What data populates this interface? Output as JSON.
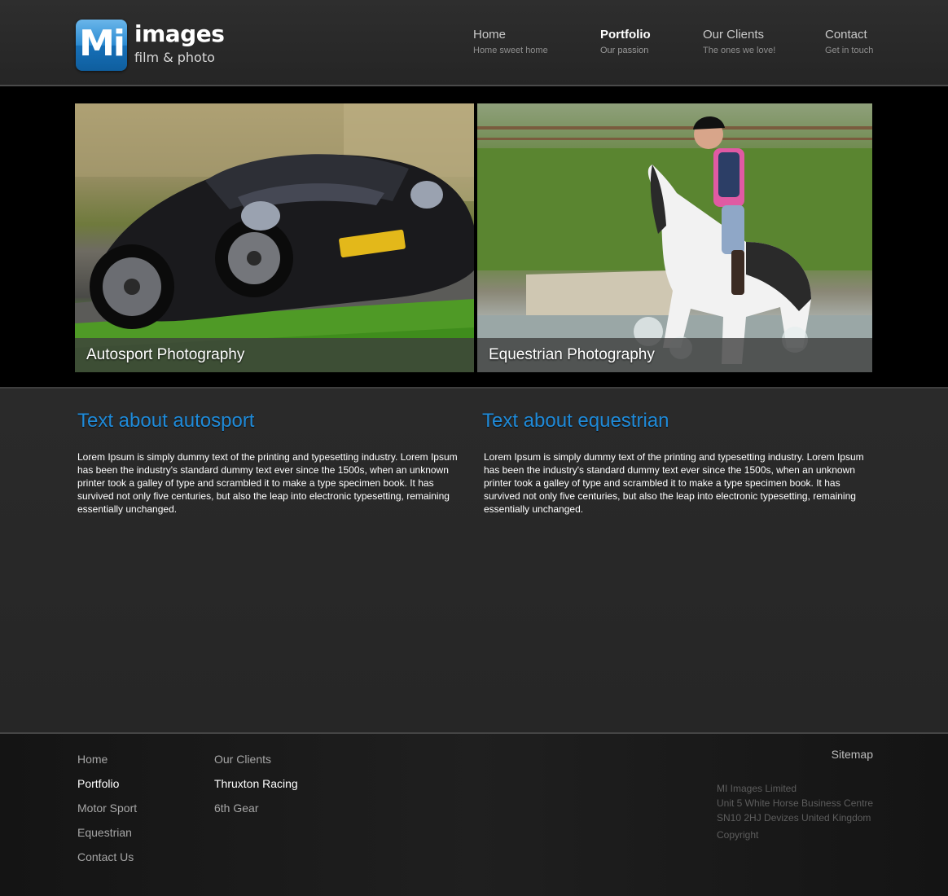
{
  "logo": {
    "badge_text": "Mi",
    "title": "images",
    "subtitle": "film & photo",
    "badge_color": "#2b8bd2"
  },
  "nav": {
    "items": [
      {
        "title": "Home",
        "subtitle": "Home sweet home",
        "active": false
      },
      {
        "title": "Portfolio",
        "subtitle": "Our passion",
        "active": true
      },
      {
        "title": "Our Clients",
        "subtitle": "The ones we love!",
        "active": false
      },
      {
        "title": "Contact",
        "subtitle": "Get in touch",
        "active": false
      }
    ]
  },
  "gallery": {
    "tiles": [
      {
        "caption": "Autosport Photography",
        "image": "black sports car photo"
      },
      {
        "caption": "Equestrian Photography",
        "image": "horse rider splashing through water photo"
      }
    ]
  },
  "content": {
    "columns": [
      {
        "heading": "Text about autosport",
        "body": "Lorem Ipsum is simply dummy text of the printing and typesetting industry. Lorem Ipsum has been the industry's standard dummy text ever since the 1500s, when an unknown printer took a galley of type and scrambled it to make a type specimen book. It has survived not only five centuries, but also the leap into electronic typesetting, remaining essentially unchanged."
      },
      {
        "heading": "Text about equestrian",
        "body": "Lorem Ipsum is simply dummy text of the printing and typesetting industry. Lorem Ipsum has been the industry's standard dummy text ever since the 1500s, when an unknown printer took a galley of type and scrambled it to make a type specimen book. It has survived not only five centuries, but also the leap into electronic typesetting, remaining essentially unchanged."
      }
    ],
    "heading_color": "#1f8ad8"
  },
  "footer": {
    "col1": [
      "Home",
      "Portfolio",
      "Motor Sport",
      "Equestrian",
      "Contact Us"
    ],
    "col1_active": "Portfolio",
    "col2": [
      "Our Clients",
      "Thruxton Racing",
      "6th Gear"
    ],
    "col2_active": "Thruxton Racing",
    "sitemap": "Sitemap",
    "address": {
      "line1": "MI Images Limited",
      "line2": "Unit 5 White Horse Business Centre",
      "line3": "SN10 2HJ Devizes United Kingdom",
      "copyright": "Copyright"
    }
  }
}
